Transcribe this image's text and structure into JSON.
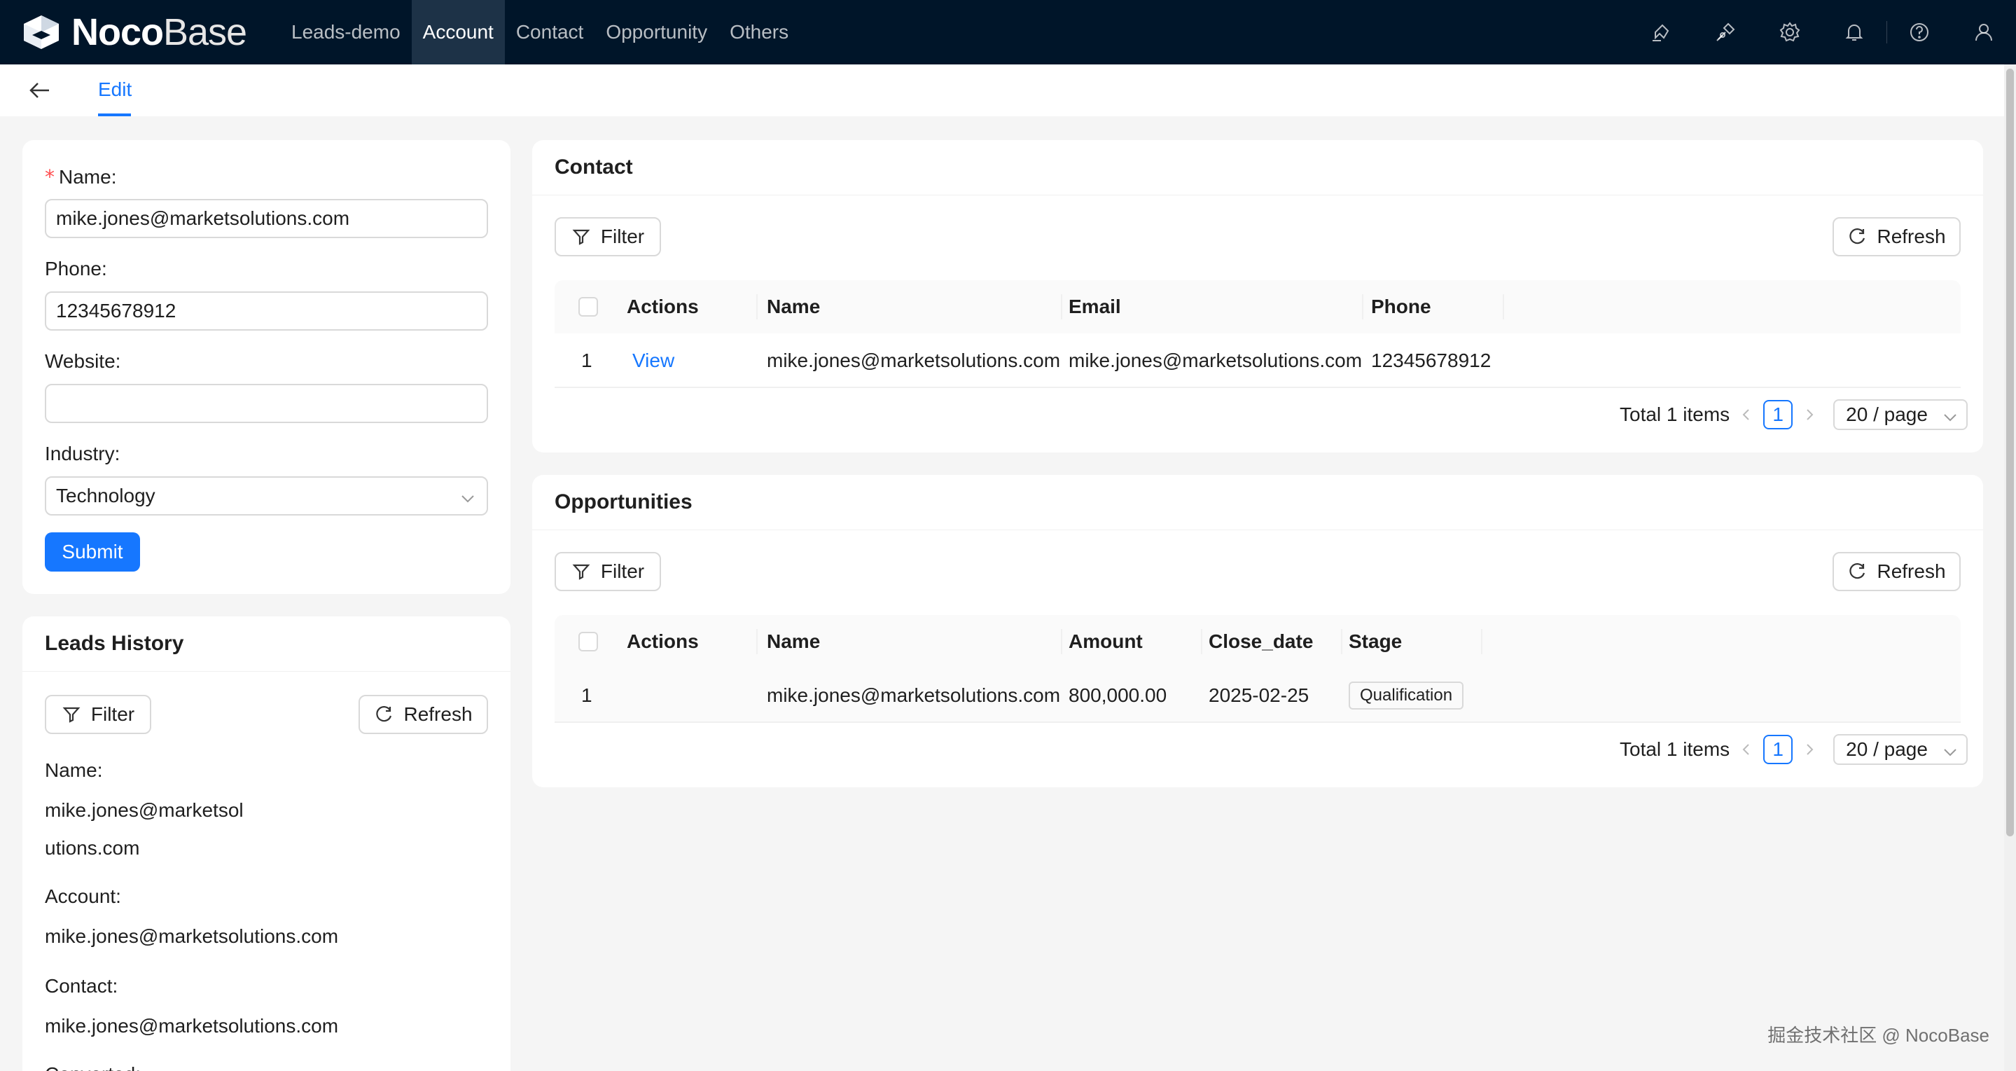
{
  "app": {
    "logo_bold": "Noco",
    "logo_light": "Base",
    "nav": [
      "Leads-demo",
      "Account",
      "Contact",
      "Opportunity",
      "Others"
    ],
    "active_nav": "Account",
    "icons": [
      "highlight-icon",
      "plugin-icon",
      "settings-icon",
      "bell-icon",
      "help-icon",
      "user-icon"
    ]
  },
  "subheader": {
    "tab": "Edit"
  },
  "form": {
    "name_label": "Name",
    "name_value": "mike.jones@marketsolutions.com",
    "phone_label": "Phone",
    "phone_value": "12345678912",
    "website_label": "Website",
    "website_value": "",
    "industry_label": "Industry",
    "industry_value": "Technology",
    "submit": "Submit"
  },
  "leads_history": {
    "title": "Leads History",
    "filter": "Filter",
    "refresh": "Refresh",
    "name_label": "Name",
    "name_value_line1": "mike.jones@marketsol",
    "name_value_line2": "utions.com",
    "account_label": "Account",
    "account_value": "mike.jones@marketsolutions.com",
    "contact_label": "Contact",
    "contact_value": "mike.jones@marketsolutions.com",
    "next_label": "Converted"
  },
  "contact_block": {
    "title": "Contact",
    "filter": "Filter",
    "refresh": "Refresh",
    "columns": [
      "Actions",
      "Name",
      "Email",
      "Phone"
    ],
    "rows": [
      {
        "index": "1",
        "action": "View",
        "name": "mike.jones@marketsolutions.com",
        "email": "mike.jones@marketsolutions.com",
        "phone": "12345678912"
      }
    ],
    "total": "Total 1 items",
    "page": "1",
    "page_size": "20 / page"
  },
  "opportunities_block": {
    "title": "Opportunities",
    "filter": "Filter",
    "refresh": "Refresh",
    "columns": [
      "Actions",
      "Name",
      "Amount",
      "Close_date",
      "Stage"
    ],
    "rows": [
      {
        "index": "1",
        "name": "mike.jones@marketsolutions.com",
        "amount": "800,000.00",
        "close_date": "2025-02-25",
        "stage": "Qualification"
      }
    ],
    "total": "Total 1 items",
    "page": "1",
    "page_size": "20 / page"
  },
  "watermark": "掘金技术社区 @ NocoBase",
  "colors": {
    "nav_bg": "#001529",
    "primary": "#1677ff",
    "page_bg": "#f5f5f5",
    "required": "#ff4d4f"
  }
}
